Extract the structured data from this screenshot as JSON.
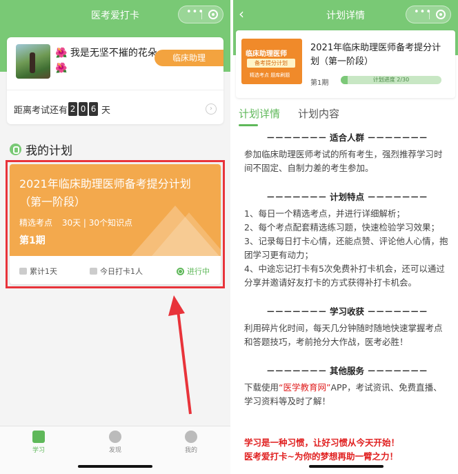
{
  "left": {
    "nav_title": "医考爱打卡",
    "capsule_menu": "•••",
    "profile": {
      "name": "🌺 我是无坚不摧的花朵🌺",
      "role": "临床助理",
      "countdown_label": "距离考试还有",
      "countdown_digits": [
        "2",
        "0",
        "6"
      ],
      "countdown_unit": "天"
    },
    "section_title": "我的计划",
    "plan": {
      "title": "2021年临床助理医师备考提分计划（第一阶段）",
      "meta_a": "精选考点",
      "meta_b": "30天 | 30个知识点",
      "period": "第1期",
      "accumulated": "累计1天",
      "today": "今日打卡1人",
      "status": "进行中"
    },
    "tabbar": [
      {
        "label": "学习",
        "icon": "book-icon"
      },
      {
        "label": "发现",
        "icon": "compass-icon"
      },
      {
        "label": "我的",
        "icon": "user-icon"
      }
    ]
  },
  "right": {
    "nav_title": "计划详情",
    "capsule_menu": "•••",
    "course": {
      "thumb_line1": "临床助理医师",
      "thumb_line2": "备考提分计划",
      "thumb_line3": "精选考点 题库刷题",
      "title": "2021年临床助理医师备考提分计划（第一阶段）",
      "period": "第1期",
      "progress_text": "计划进度 2/30",
      "progress_fraction": 0.0667
    },
    "tabs": [
      "计划详情",
      "计划内容"
    ],
    "sections": [
      {
        "heading": "－－－－－－－  适合人群  －－－－－－－",
        "lines": [
          "参加临床助理医师考试的所有考生，强烈推荐学习时间不固定、自制力差的考生参加。"
        ]
      },
      {
        "heading": "－－－－－－－  计划特点  －－－－－－－",
        "lines": [
          "1、每日一个精选考点，并进行详细解析；",
          "2、每个考点配套精选练习题，快速检验学习效果；",
          "3、记录每日打卡心情，还能点赞、评论他人心情，抱团学习更有动力；",
          "4、中途忘记打卡有5次免费补打卡机会，还可以通过分享并邀请好友打卡的方式获得补打卡机会。"
        ]
      },
      {
        "heading": "－－－－－－－  学习收获  －－－－－－－",
        "lines": [
          "利用碎片化时间，每天几分钟随时随地快速掌握考点和答题技巧，考前抢分大作战，医考必胜！"
        ]
      },
      {
        "heading": "－－－－－－－  其他服务  －－－－－－－",
        "prefix": "下载使用",
        "highlight": "“医学教育网”",
        "suffix": "APP，考试资讯、免费直播、学习资料等及时了解！"
      }
    ],
    "slogan_1": "学习是一种习惯，让好习惯从今天开始！",
    "slogan_2": "医考爱打卡~为你的梦想再助一臂之力！"
  },
  "colors": {
    "brand_green": "#79c975",
    "plan_orange": "#f3a94d",
    "annotation_red": "#e8333a"
  }
}
